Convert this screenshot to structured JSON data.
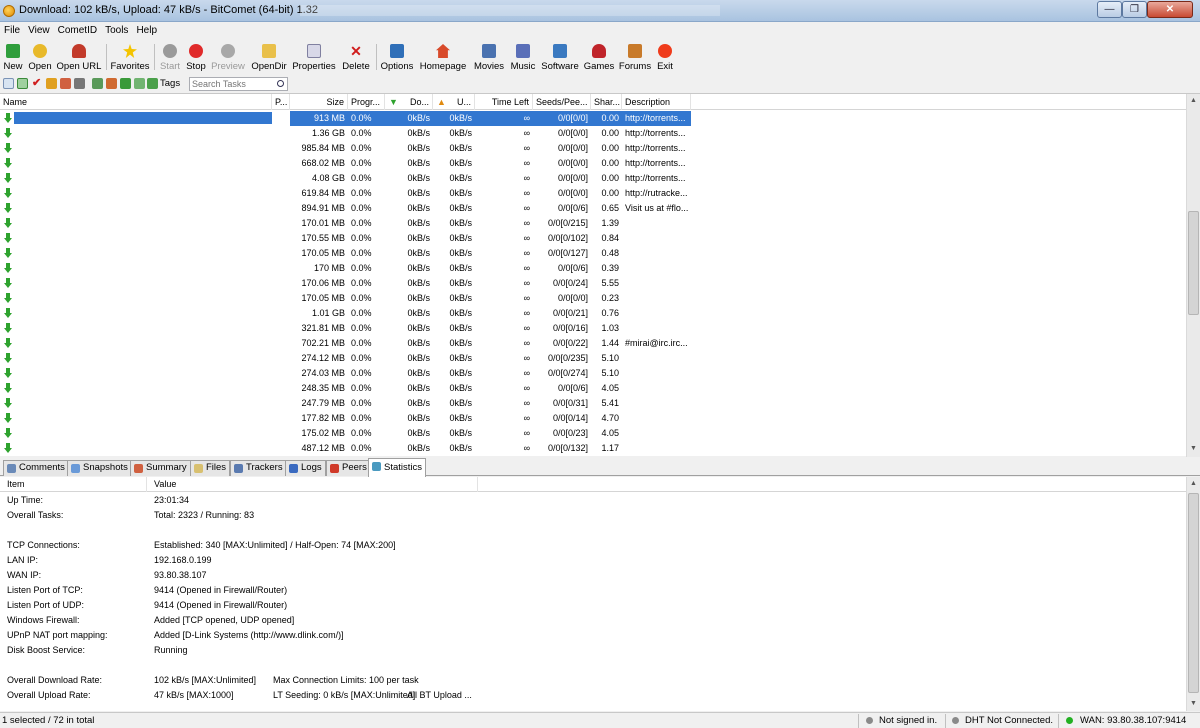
{
  "window": {
    "title": "Download: 102 kB/s, Upload: 47 kB/s - BitComet (64-bit) 1.32",
    "minimize": "—",
    "maximize": "❐",
    "close": "✕"
  },
  "menu": [
    "File",
    "View",
    "CometID",
    "Tools",
    "Help"
  ],
  "toolbar": {
    "new": "New",
    "open": "Open",
    "open_url": "Open URL",
    "favorites": "Favorites",
    "start": "Start",
    "stop": "Stop",
    "preview": "Preview",
    "opendir": "OpenDir",
    "properties": "Properties",
    "delete": "Delete",
    "options": "Options",
    "homepage": "Homepage",
    "movies": "Movies",
    "music": "Music",
    "software": "Software",
    "games": "Games",
    "forums": "Forums",
    "exit": "Exit"
  },
  "toolbar2": {
    "tags": "Tags",
    "search_placeholder": "Search Tasks"
  },
  "tasks": {
    "columns": [
      "Name",
      "P...",
      "Size",
      "Progr...",
      "Do...",
      "U...",
      "Time Left",
      "Seeds/Pee...",
      "Shar...",
      "Description"
    ],
    "rows": [
      [
        "913 MB",
        "0.0%",
        "0kB/s",
        "0kB/s",
        "∞",
        "0/0[0/0]",
        "0.00",
        "http://torrents..."
      ],
      [
        "1.36 GB",
        "0.0%",
        "0kB/s",
        "0kB/s",
        "∞",
        "0/0[0/0]",
        "0.00",
        "http://torrents..."
      ],
      [
        "985.84 MB",
        "0.0%",
        "0kB/s",
        "0kB/s",
        "∞",
        "0/0[0/0]",
        "0.00",
        "http://torrents..."
      ],
      [
        "668.02 MB",
        "0.0%",
        "0kB/s",
        "0kB/s",
        "∞",
        "0/0[0/0]",
        "0.00",
        "http://torrents..."
      ],
      [
        "4.08 GB",
        "0.0%",
        "0kB/s",
        "0kB/s",
        "∞",
        "0/0[0/0]",
        "0.00",
        "http://torrents..."
      ],
      [
        "619.84 MB",
        "0.0%",
        "0kB/s",
        "0kB/s",
        "∞",
        "0/0[0/0]",
        "0.00",
        "http://rutracke..."
      ],
      [
        "894.91 MB",
        "0.0%",
        "0kB/s",
        "0kB/s",
        "∞",
        "0/0[0/6]",
        "0.65",
        "Visit us at #flo..."
      ],
      [
        "170.01 MB",
        "0.0%",
        "0kB/s",
        "0kB/s",
        "∞",
        "0/0[0/215]",
        "1.39",
        ""
      ],
      [
        "170.55 MB",
        "0.0%",
        "0kB/s",
        "0kB/s",
        "∞",
        "0/0[0/102]",
        "0.84",
        ""
      ],
      [
        "170.05 MB",
        "0.0%",
        "0kB/s",
        "0kB/s",
        "∞",
        "0/0[0/127]",
        "0.48",
        ""
      ],
      [
        "170 MB",
        "0.0%",
        "0kB/s",
        "0kB/s",
        "∞",
        "0/0[0/6]",
        "0.39",
        ""
      ],
      [
        "170.06 MB",
        "0.0%",
        "0kB/s",
        "0kB/s",
        "∞",
        "0/0[0/24]",
        "5.55",
        ""
      ],
      [
        "170.05 MB",
        "0.0%",
        "0kB/s",
        "0kB/s",
        "∞",
        "0/0[0/0]",
        "0.23",
        ""
      ],
      [
        "1.01 GB",
        "0.0%",
        "0kB/s",
        "0kB/s",
        "∞",
        "0/0[0/21]",
        "0.76",
        ""
      ],
      [
        "321.81 MB",
        "0.0%",
        "0kB/s",
        "0kB/s",
        "∞",
        "0/0[0/16]",
        "1.03",
        ""
      ],
      [
        "702.21 MB",
        "0.0%",
        "0kB/s",
        "0kB/s",
        "∞",
        "0/0[0/22]",
        "1.44",
        "#mirai@irc.irc..."
      ],
      [
        "274.12 MB",
        "0.0%",
        "0kB/s",
        "0kB/s",
        "∞",
        "0/0[0/235]",
        "5.10",
        ""
      ],
      [
        "274.03 MB",
        "0.0%",
        "0kB/s",
        "0kB/s",
        "∞",
        "0/0[0/274]",
        "5.10",
        ""
      ],
      [
        "248.35 MB",
        "0.0%",
        "0kB/s",
        "0kB/s",
        "∞",
        "0/0[0/6]",
        "4.05",
        ""
      ],
      [
        "247.79 MB",
        "0.0%",
        "0kB/s",
        "0kB/s",
        "∞",
        "0/0[0/31]",
        "5.41",
        ""
      ],
      [
        "177.82 MB",
        "0.0%",
        "0kB/s",
        "0kB/s",
        "∞",
        "0/0[0/14]",
        "4.70",
        ""
      ],
      [
        "175.02 MB",
        "0.0%",
        "0kB/s",
        "0kB/s",
        "∞",
        "0/0[0/23]",
        "4.05",
        ""
      ],
      [
        "487.12 MB",
        "0.0%",
        "0kB/s",
        "0kB/s",
        "∞",
        "0/0[0/132]",
        "1.17",
        ""
      ]
    ]
  },
  "tabs": [
    "Comments",
    "Snapshots",
    "Summary",
    "Files",
    "Trackers",
    "Logs",
    "Peers",
    "Statistics"
  ],
  "stats": {
    "columns": [
      "Item",
      "Value"
    ],
    "rows": [
      {
        "item": "Up Time:",
        "value": "23:01:34"
      },
      {
        "item": "Overall Tasks:",
        "value": "Total: 2323 / Running: 83"
      },
      {
        "item": "",
        "value": ""
      },
      {
        "item": "TCP Connections:",
        "value": "Established: 340 [MAX:Unlimited] / Half-Open: 74 [MAX:200]"
      },
      {
        "item": "LAN IP:",
        "value": "192.168.0.199"
      },
      {
        "item": "WAN IP:",
        "value": "93.80.38.107"
      },
      {
        "item": "Listen Port of TCP:",
        "value": "9414 (Opened in Firewall/Router)"
      },
      {
        "item": "Listen Port of UDP:",
        "value": "9414 (Opened in Firewall/Router)"
      },
      {
        "item": "Windows Firewall:",
        "value": "Added [TCP opened, UDP opened]"
      },
      {
        "item": "UPnP NAT port mapping:",
        "value": "Added [D-Link Systems (http://www.dlink.com/)]"
      },
      {
        "item": "Disk Boost Service:",
        "value": "Running"
      },
      {
        "item": "",
        "value": ""
      },
      {
        "item": "Overall Download Rate:",
        "value": "102 kB/s [MAX:Unlimited]",
        "value2": "Max Connection Limits: 100 per task"
      },
      {
        "item": "Overall Upload Rate:",
        "value": "47 kB/s [MAX:1000]",
        "value2": "LT Seeding: 0 kB/s [MAX:Unlimited]",
        "value3": "All BT Upload ..."
      }
    ]
  },
  "status": {
    "selection": "1 selected / 72 in total",
    "signin": "Not signed in.",
    "dht": "DHT Not Connected.",
    "wan": "WAN: 93.80.38.107:9414"
  },
  "colors": {
    "selection": "#3277d0",
    "download_arrow": "#2ea32e",
    "wan_dot": "#22b022",
    "signin_dot": "#8a8a8a",
    "dht_dot": "#8a8a8a"
  }
}
